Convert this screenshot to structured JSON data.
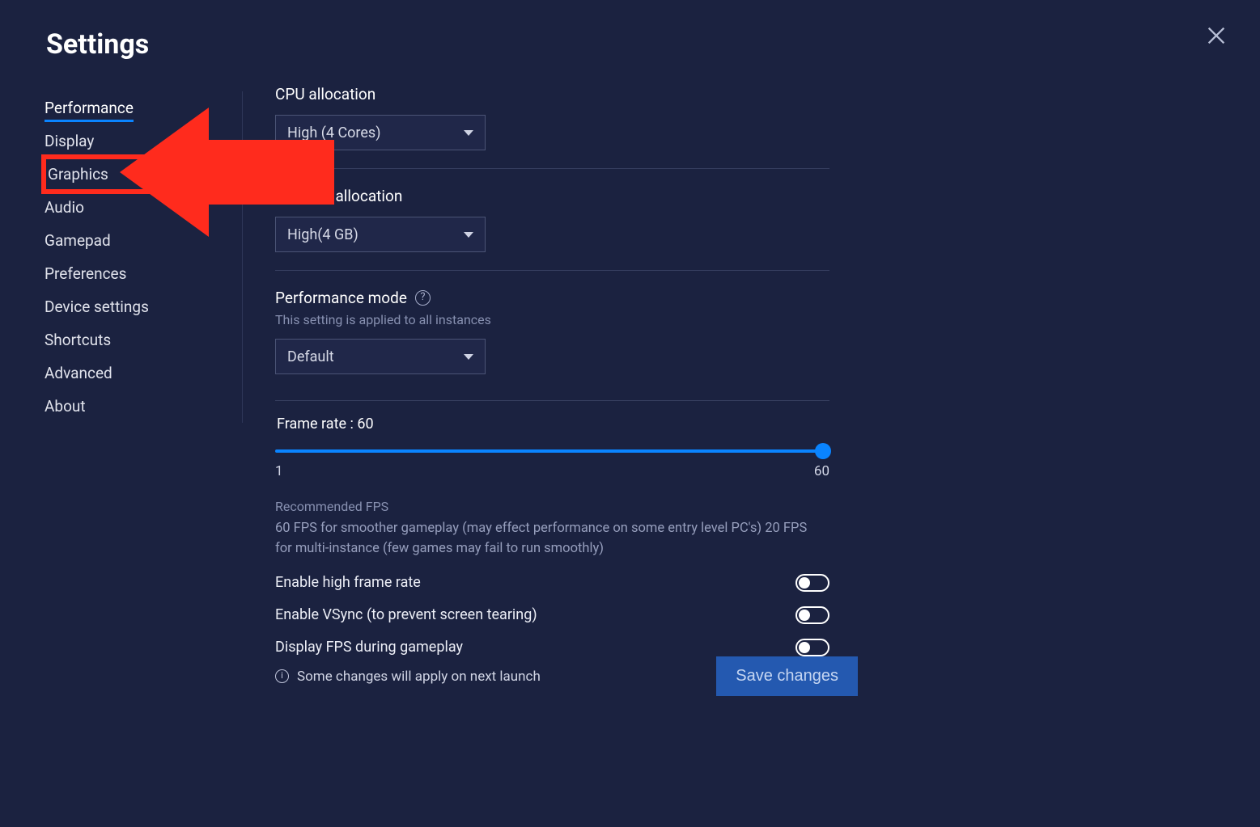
{
  "title": "Settings",
  "sidebar": {
    "items": [
      {
        "label": "Performance",
        "active": true
      },
      {
        "label": "Display"
      },
      {
        "label": "Graphics",
        "highlight": true
      },
      {
        "label": "Audio"
      },
      {
        "label": "Gamepad"
      },
      {
        "label": "Preferences"
      },
      {
        "label": "Device settings"
      },
      {
        "label": "Shortcuts"
      },
      {
        "label": "Advanced"
      },
      {
        "label": "About"
      }
    ]
  },
  "cpu": {
    "label": "CPU allocation",
    "value": "High (4 Cores)"
  },
  "memory": {
    "label": "Memory allocation",
    "value": "High(4 GB)"
  },
  "perfmode": {
    "label": "Performance mode",
    "sub": "This setting is applied to all instances",
    "value": "Default"
  },
  "framerate": {
    "label_prefix": "Frame rate : ",
    "value": "60",
    "min": "1",
    "max": "60",
    "rec_head": "Recommended FPS",
    "rec_body": "60 FPS for smoother gameplay (may effect performance on some entry level PC's) 20 FPS for multi-instance (few games may fail to run smoothly)"
  },
  "toggles": {
    "hifr": "Enable high frame rate",
    "vsync": "Enable VSync (to prevent screen tearing)",
    "showfps": "Display FPS during gameplay"
  },
  "footer": {
    "info": "Some changes will apply on next launch",
    "save": "Save changes"
  }
}
